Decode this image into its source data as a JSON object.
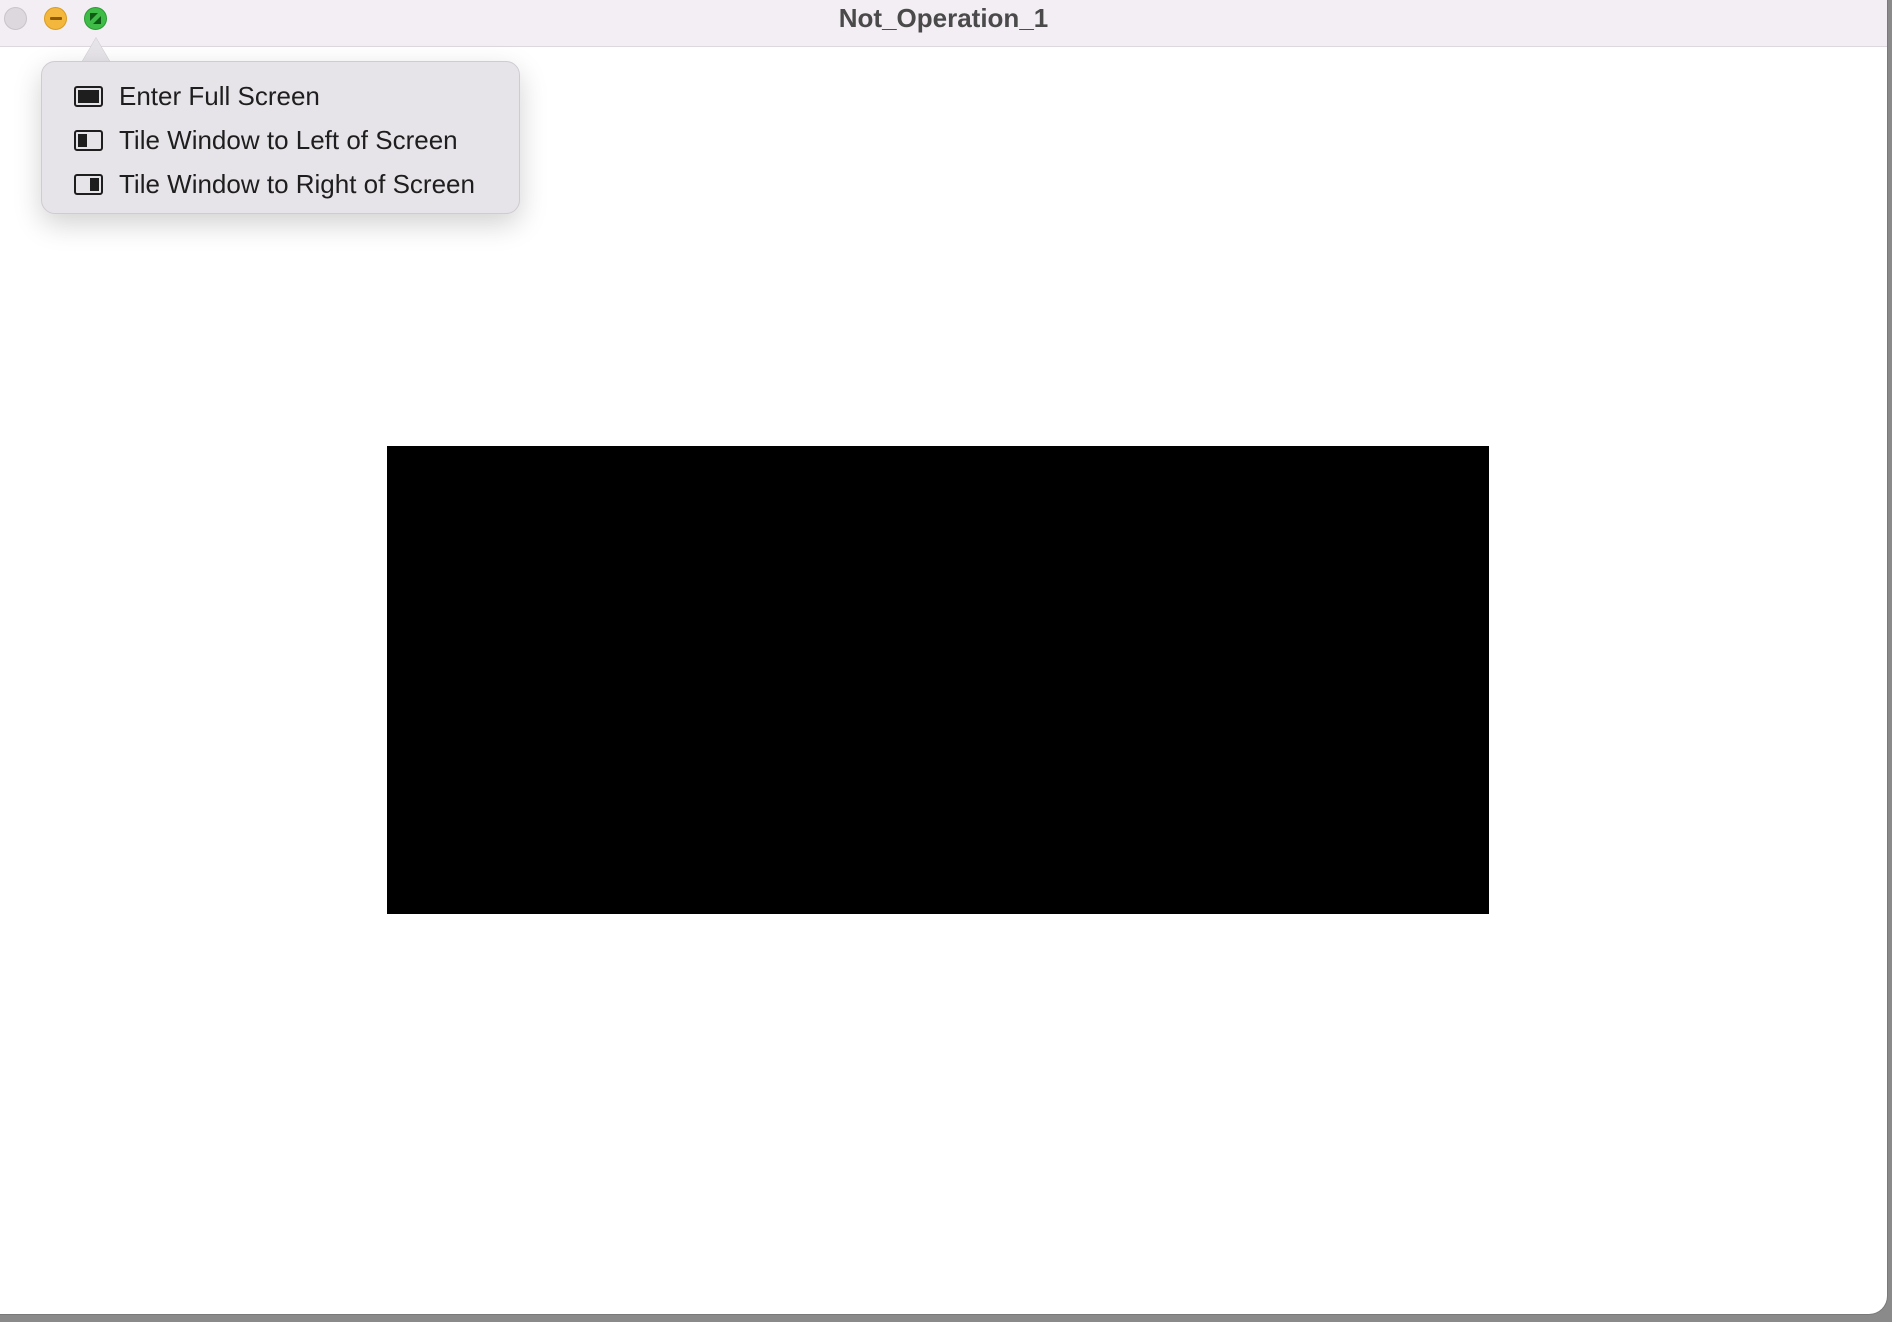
{
  "window": {
    "title": "Not_Operation_1"
  },
  "traffic_lights": {
    "close_icon": "close-icon",
    "minimize_icon": "minimize-icon",
    "zoom_icon": "zoom-icon",
    "colors": {
      "close": "#dcd8dd",
      "minimize": "#f4b73d",
      "zoom": "#3fbc47"
    }
  },
  "zoom_menu": {
    "items": [
      {
        "label": "Enter Full Screen",
        "icon": "full-screen-icon"
      },
      {
        "label": "Tile Window to Left of Screen",
        "icon": "tile-left-icon"
      },
      {
        "label": "Tile Window to Right of Screen",
        "icon": "tile-right-icon"
      }
    ]
  },
  "content": {
    "rect_color": "#000000"
  }
}
